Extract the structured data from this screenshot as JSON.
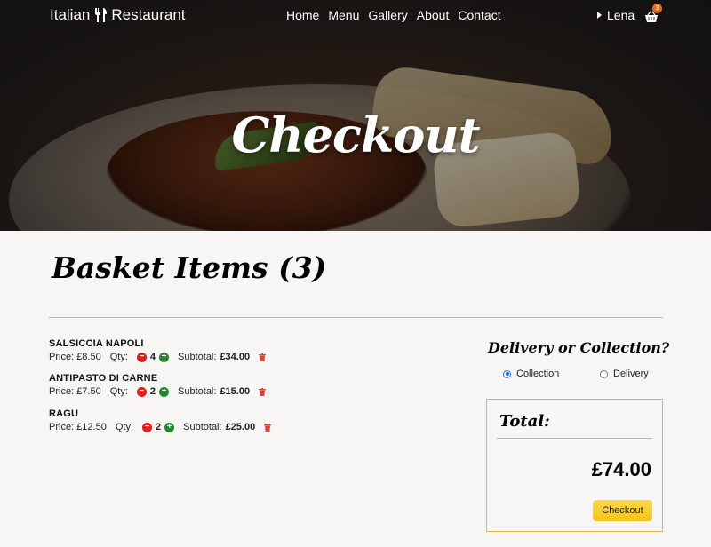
{
  "nav": {
    "brand_left": "Italian",
    "brand_right": "Restaurant",
    "links": [
      "Home",
      "Menu",
      "Gallery",
      "About",
      "Contact"
    ],
    "user": "Lena",
    "cart_count": "3"
  },
  "hero": {
    "title": "Checkout"
  },
  "basket": {
    "title": "Basket Items (3)",
    "items": [
      {
        "name": "SALSICCIA NAPOLI",
        "price_label": "Price:",
        "price": "£8.50",
        "qty_label": "Qty:",
        "qty": "4",
        "subtotal_label": "Subtotal:",
        "subtotal": "£34.00"
      },
      {
        "name": "ANTIPASTO DI CARNE",
        "price_label": "Price:",
        "price": "£7.50",
        "qty_label": "Qty:",
        "qty": "2",
        "subtotal_label": "Subtotal:",
        "subtotal": "£15.00"
      },
      {
        "name": "RAGU",
        "price_label": "Price:",
        "price": "£12.50",
        "qty_label": "Qty:",
        "qty": "2",
        "subtotal_label": "Subtotal:",
        "subtotal": "£25.00"
      }
    ]
  },
  "delivery": {
    "title": "Delivery or Collection?",
    "options": [
      "Collection",
      "Delivery"
    ],
    "selected": "Collection"
  },
  "summary": {
    "label": "Total:",
    "amount": "£74.00",
    "checkout_label": "Checkout"
  },
  "colors": {
    "accent": "#e5b64a",
    "checkout": "#f3c417",
    "minus": "#e0201f",
    "plus": "#1d8a2c",
    "trash": "#e0403a",
    "radio": "#1a73e8"
  },
  "icons": [
    "fork-knife-icon",
    "caret-right-icon",
    "basket-icon",
    "minus-icon",
    "plus-icon",
    "trash-icon"
  ]
}
